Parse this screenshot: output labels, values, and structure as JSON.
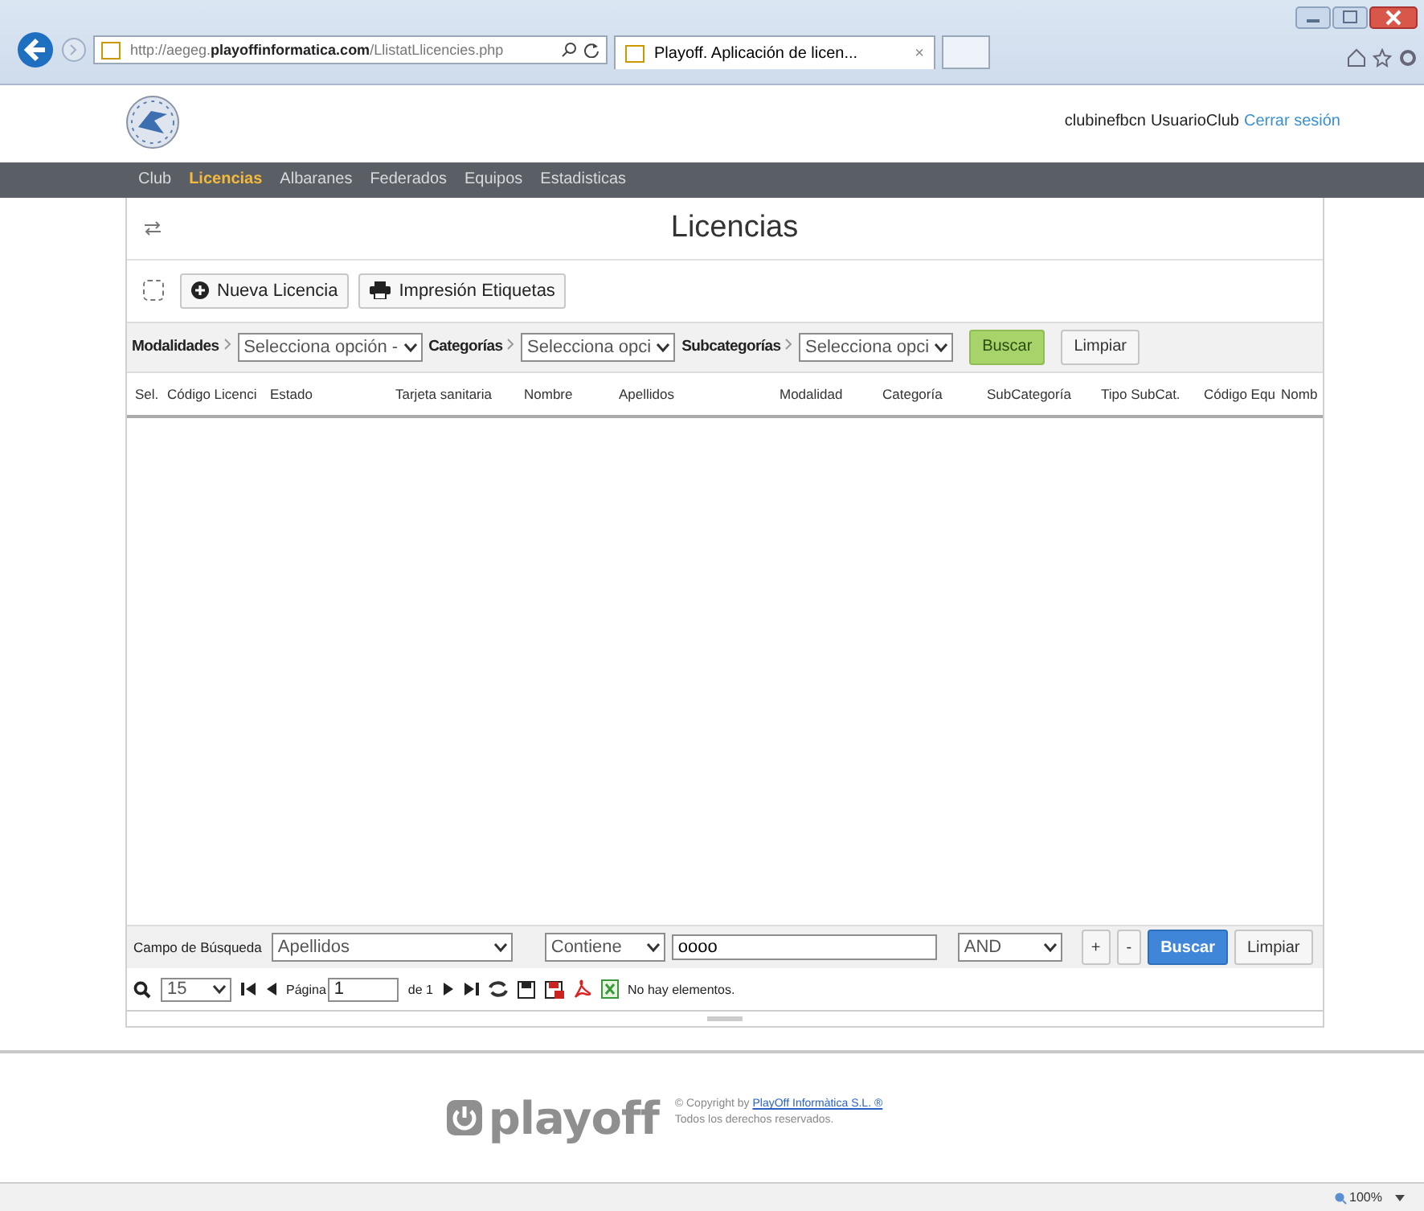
{
  "browser": {
    "address": "http://aegeg.**playoffinformatica.com**/LlistatLlicencies.php",
    "tab": {
      "title": "Playoff. Aplicación de licen...",
      "close": "×"
    },
    "zoom": "100%"
  },
  "header": {
    "user": "clubinefbcn",
    "role": "UsuarioClub",
    "logout": "Cerrar sesión"
  },
  "nav": [
    {
      "label": "Club",
      "selected": false
    },
    {
      "label": "Licencias",
      "selected": true
    },
    {
      "label": "Albaranes",
      "selected": false
    },
    {
      "label": "Federados",
      "selected": false
    },
    {
      "label": "Equipos",
      "selected": false
    },
    {
      "label": "Estadisticas",
      "selected": false
    }
  ],
  "page_title": "Licencias",
  "select_all": {
    "checked": false
  },
  "actions": [
    {
      "label": "Nueva Licencia",
      "kind": "add"
    },
    {
      "label": "Impresión Etiquetas",
      "kind": "print"
    }
  ],
  "filters": [
    {
      "label": "Modalidades",
      "value": "Selecciona opción -"
    },
    {
      "label": "Categorías",
      "value": "Selecciona opci"
    },
    {
      "label": "Subcategorías",
      "value": "Selecciona opci"
    }
  ],
  "filter_buttons": [
    {
      "label": "Buscar",
      "kind": "primary"
    },
    {
      "label": "Limpiar",
      "kind": "plain"
    }
  ],
  "table": {
    "columns": [
      "Sel.",
      "Código Licenci",
      "Estado",
      "Tarjeta sanitaria",
      "Nombre",
      "Apellidos",
      "Modalidad",
      "Categoría",
      "SubCategoría",
      "Tipo SubCat.",
      "Código Equ",
      "Nomb"
    ]
  },
  "search": {
    "label": "Campo de Búsqueda",
    "field": "Apellidos",
    "operator": "Contiene",
    "value": "oooo",
    "logic": "AND",
    "buttons": [
      {
        "label": "+",
        "kind": "plain"
      },
      {
        "label": "-",
        "kind": "plain"
      },
      {
        "label": "Buscar",
        "kind": "blue"
      },
      {
        "label": "Limpiar",
        "kind": "plain"
      }
    ]
  },
  "pager": {
    "page_size": "15",
    "page_label": "Página",
    "page": "1",
    "of": "de 1",
    "message": "No hay elementos."
  },
  "footer": {
    "logo": "playoff",
    "copyright": "© Copyright by ",
    "company": "PlayOff Informàtica S.L. ®",
    "rights": "Todos los derechos reservados."
  }
}
